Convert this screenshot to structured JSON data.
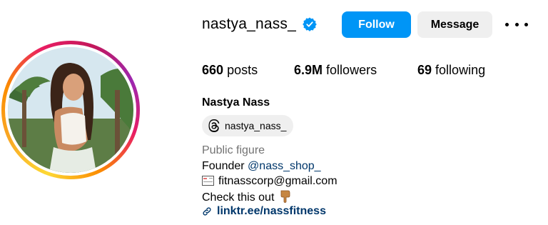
{
  "profile": {
    "username": "nastya_nass_",
    "verified": true,
    "full_name": "Nastya Nass",
    "threads_handle": "nastya_nass_",
    "category": "Public figure"
  },
  "actions": {
    "follow_label": "Follow",
    "message_label": "Message"
  },
  "stats": {
    "posts_count": "660",
    "posts_label": "posts",
    "followers_count": "6.9M",
    "followers_label": "followers",
    "following_count": "69",
    "following_label": "following"
  },
  "bio": {
    "founder_text": "Founder",
    "founder_mention": "@nass_shop_",
    "email": "fitnasscorp@gmail.com",
    "check_text": "Check this out",
    "link": "linktr.ee/nassfitness"
  },
  "icons": {
    "verified": "verified-badge-icon",
    "more": "more-options-icon",
    "threads": "threads-icon",
    "email": "envelope-emoji-icon",
    "hand": "pointing-down-emoji-icon",
    "link": "link-icon"
  },
  "colors": {
    "primary_button": "#0095f6",
    "secondary_button": "#efefef",
    "link": "#00376b",
    "muted": "#737373"
  }
}
